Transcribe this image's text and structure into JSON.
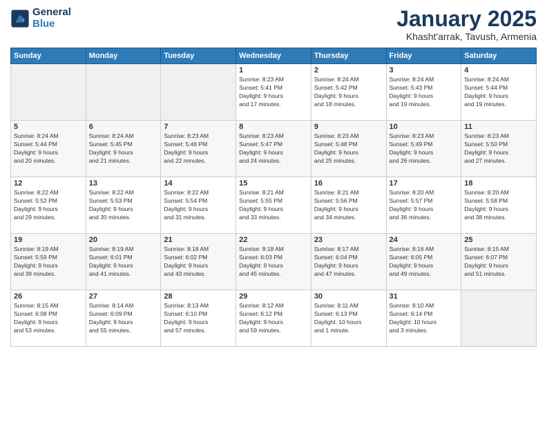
{
  "header": {
    "logo_line1": "General",
    "logo_line2": "Blue",
    "month_title": "January 2025",
    "subtitle": "Khasht'arrak, Tavush, Armenia"
  },
  "weekdays": [
    "Sunday",
    "Monday",
    "Tuesday",
    "Wednesday",
    "Thursday",
    "Friday",
    "Saturday"
  ],
  "weeks": [
    [
      {
        "day": "",
        "info": ""
      },
      {
        "day": "",
        "info": ""
      },
      {
        "day": "",
        "info": ""
      },
      {
        "day": "1",
        "info": "Sunrise: 8:23 AM\nSunset: 5:41 PM\nDaylight: 9 hours\nand 17 minutes."
      },
      {
        "day": "2",
        "info": "Sunrise: 8:24 AM\nSunset: 5:42 PM\nDaylight: 9 hours\nand 18 minutes."
      },
      {
        "day": "3",
        "info": "Sunrise: 8:24 AM\nSunset: 5:43 PM\nDaylight: 9 hours\nand 19 minutes."
      },
      {
        "day": "4",
        "info": "Sunrise: 8:24 AM\nSunset: 5:44 PM\nDaylight: 9 hours\nand 19 minutes."
      }
    ],
    [
      {
        "day": "5",
        "info": "Sunrise: 8:24 AM\nSunset: 5:44 PM\nDaylight: 9 hours\nand 20 minutes."
      },
      {
        "day": "6",
        "info": "Sunrise: 8:24 AM\nSunset: 5:45 PM\nDaylight: 9 hours\nand 21 minutes."
      },
      {
        "day": "7",
        "info": "Sunrise: 8:23 AM\nSunset: 5:46 PM\nDaylight: 9 hours\nand 22 minutes."
      },
      {
        "day": "8",
        "info": "Sunrise: 8:23 AM\nSunset: 5:47 PM\nDaylight: 9 hours\nand 24 minutes."
      },
      {
        "day": "9",
        "info": "Sunrise: 8:23 AM\nSunset: 5:48 PM\nDaylight: 9 hours\nand 25 minutes."
      },
      {
        "day": "10",
        "info": "Sunrise: 8:23 AM\nSunset: 5:49 PM\nDaylight: 9 hours\nand 26 minutes."
      },
      {
        "day": "11",
        "info": "Sunrise: 8:23 AM\nSunset: 5:50 PM\nDaylight: 9 hours\nand 27 minutes."
      }
    ],
    [
      {
        "day": "12",
        "info": "Sunrise: 8:22 AM\nSunset: 5:52 PM\nDaylight: 9 hours\nand 29 minutes."
      },
      {
        "day": "13",
        "info": "Sunrise: 8:22 AM\nSunset: 5:53 PM\nDaylight: 9 hours\nand 30 minutes."
      },
      {
        "day": "14",
        "info": "Sunrise: 8:22 AM\nSunset: 5:54 PM\nDaylight: 9 hours\nand 31 minutes."
      },
      {
        "day": "15",
        "info": "Sunrise: 8:21 AM\nSunset: 5:55 PM\nDaylight: 9 hours\nand 33 minutes."
      },
      {
        "day": "16",
        "info": "Sunrise: 8:21 AM\nSunset: 5:56 PM\nDaylight: 9 hours\nand 34 minutes."
      },
      {
        "day": "17",
        "info": "Sunrise: 8:20 AM\nSunset: 5:57 PM\nDaylight: 9 hours\nand 36 minutes."
      },
      {
        "day": "18",
        "info": "Sunrise: 8:20 AM\nSunset: 5:58 PM\nDaylight: 9 hours\nand 38 minutes."
      }
    ],
    [
      {
        "day": "19",
        "info": "Sunrise: 8:19 AM\nSunset: 5:59 PM\nDaylight: 9 hours\nand 39 minutes."
      },
      {
        "day": "20",
        "info": "Sunrise: 8:19 AM\nSunset: 6:01 PM\nDaylight: 9 hours\nand 41 minutes."
      },
      {
        "day": "21",
        "info": "Sunrise: 8:18 AM\nSunset: 6:02 PM\nDaylight: 9 hours\nand 43 minutes."
      },
      {
        "day": "22",
        "info": "Sunrise: 8:18 AM\nSunset: 6:03 PM\nDaylight: 9 hours\nand 45 minutes."
      },
      {
        "day": "23",
        "info": "Sunrise: 8:17 AM\nSunset: 6:04 PM\nDaylight: 9 hours\nand 47 minutes."
      },
      {
        "day": "24",
        "info": "Sunrise: 8:16 AM\nSunset: 6:05 PM\nDaylight: 9 hours\nand 49 minutes."
      },
      {
        "day": "25",
        "info": "Sunrise: 8:15 AM\nSunset: 6:07 PM\nDaylight: 9 hours\nand 51 minutes."
      }
    ],
    [
      {
        "day": "26",
        "info": "Sunrise: 8:15 AM\nSunset: 6:08 PM\nDaylight: 9 hours\nand 53 minutes."
      },
      {
        "day": "27",
        "info": "Sunrise: 8:14 AM\nSunset: 6:09 PM\nDaylight: 9 hours\nand 55 minutes."
      },
      {
        "day": "28",
        "info": "Sunrise: 8:13 AM\nSunset: 6:10 PM\nDaylight: 9 hours\nand 57 minutes."
      },
      {
        "day": "29",
        "info": "Sunrise: 8:12 AM\nSunset: 6:12 PM\nDaylight: 9 hours\nand 59 minutes."
      },
      {
        "day": "30",
        "info": "Sunrise: 8:11 AM\nSunset: 6:13 PM\nDaylight: 10 hours\nand 1 minute."
      },
      {
        "day": "31",
        "info": "Sunrise: 8:10 AM\nSunset: 6:14 PM\nDaylight: 10 hours\nand 3 minutes."
      },
      {
        "day": "",
        "info": ""
      }
    ]
  ]
}
